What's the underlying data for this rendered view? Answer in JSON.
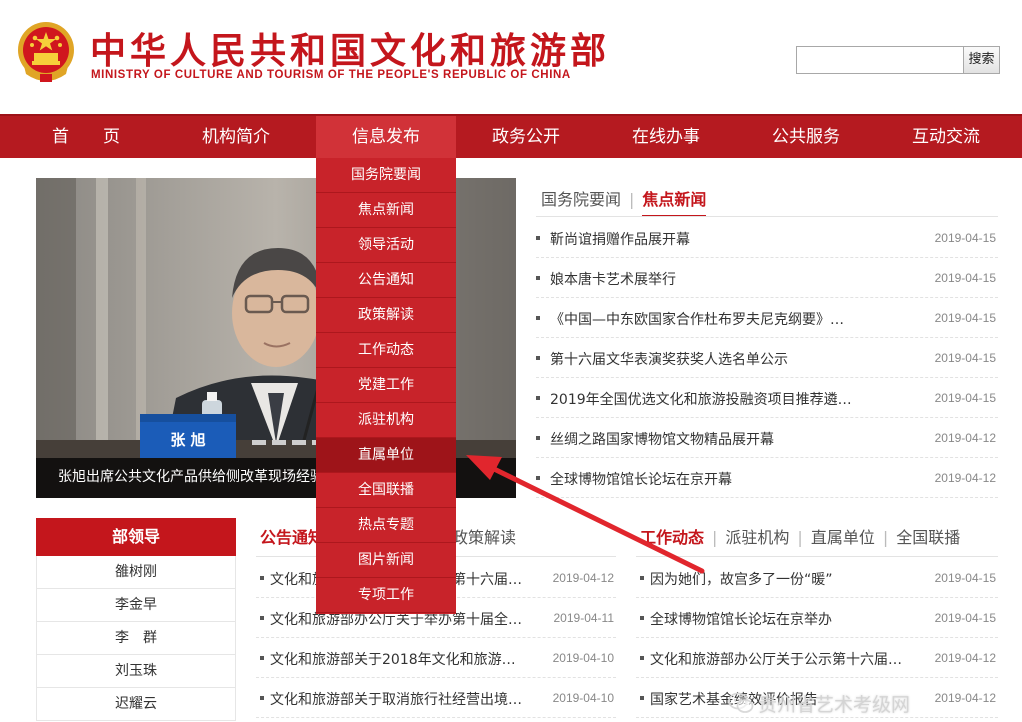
{
  "header": {
    "title": "中华人民共和国文化和旅游部",
    "subtitle": "MINISTRY OF CULTURE AND TOURISM OF THE PEOPLE'S REPUBLIC OF CHINA",
    "search_value": "",
    "search_button": "搜索"
  },
  "nav": {
    "items": [
      "首　　页",
      "机构简介",
      "信息发布",
      "政务公开",
      "在线办事",
      "公共服务",
      "互动交流"
    ],
    "active": "信息发布"
  },
  "dropdown": {
    "items": [
      "国务院要闻",
      "焦点新闻",
      "领导活动",
      "公告通知",
      "政策解读",
      "工作动态",
      "党建工作",
      "派驻机构",
      "直属单位",
      "全国联播",
      "热点专题",
      "图片新闻",
      "专项工作"
    ],
    "highlighted": "直属单位"
  },
  "photo": {
    "caption": "张旭出席公共文化产品供给侧改革现场经验交流会",
    "nameplate": "张 旭"
  },
  "top_news": {
    "tabs": [
      "国务院要闻",
      "焦点新闻"
    ],
    "active_tab": "焦点新闻",
    "items": [
      {
        "title": "靳尚谊捐赠作品展开幕",
        "date": "2019-04-15"
      },
      {
        "title": "娘本唐卡艺术展举行",
        "date": "2019-04-15"
      },
      {
        "title": "《中国—中东欧国家合作杜布罗夫尼克纲要》…",
        "date": "2019-04-15"
      },
      {
        "title": "第十六届文华表演奖获奖人选名单公示",
        "date": "2019-04-15"
      },
      {
        "title": "2019年全国优选文化和旅游投融资项目推荐遴…",
        "date": "2019-04-15"
      },
      {
        "title": "丝绸之路国家博物馆文物精品展开幕",
        "date": "2019-04-12"
      },
      {
        "title": "全球博物馆馆长论坛在京开幕",
        "date": "2019-04-12"
      }
    ]
  },
  "leaders": {
    "heading": "部领导",
    "names": [
      "雒树刚",
      "李金早",
      "李　群",
      "刘玉珠",
      "迟耀云"
    ]
  },
  "notices": {
    "active_tab": "公告通知",
    "other_tab": "政策解读",
    "items": [
      {
        "title": "文化和旅游部办公厅关于公示第十六届…",
        "date": "2019-04-12"
      },
      {
        "title": "文化和旅游部办公厅关于举办第十届全…",
        "date": "2019-04-11"
      },
      {
        "title": "文化和旅游部关于2018年文化和旅游…",
        "date": "2019-04-10"
      },
      {
        "title": "文化和旅游部关于取消旅行社经营出境…",
        "date": "2019-04-10"
      }
    ]
  },
  "work": {
    "tabs": [
      "工作动态",
      "派驻机构",
      "直属单位",
      "全国联播"
    ],
    "active_tab": "工作动态",
    "items": [
      {
        "title": "因为她们，故宫多了一份“暖”",
        "date": "2019-04-15"
      },
      {
        "title": "全球博物馆馆长论坛在京举办",
        "date": "2019-04-15"
      },
      {
        "title": "文化和旅游部办公厅关于公示第十六届…",
        "date": "2019-04-12"
      },
      {
        "title": "国家艺术基金绩效评价报告",
        "date": "2019-04-12"
      }
    ]
  },
  "watermark": "贵州省艺术考级网",
  "colors": {
    "brand_red": "#c4161c",
    "nav_bg": "#b51a20",
    "dropdown_bg": "#c8232a",
    "dropdown_hover": "#9e1419"
  }
}
